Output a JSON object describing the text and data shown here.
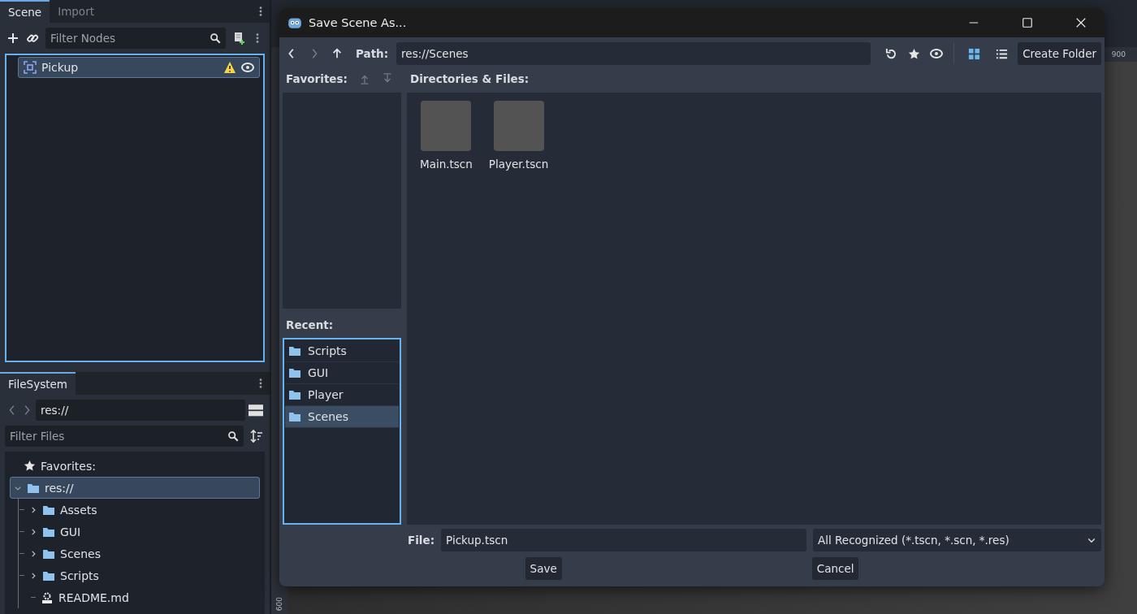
{
  "scene_dock": {
    "tabs": [
      {
        "label": "Scene",
        "selected": true
      },
      {
        "label": "Import",
        "selected": false
      }
    ],
    "filter": {
      "placeholder": "Filter Nodes"
    },
    "tree": [
      {
        "label": "Pickup",
        "selected": true,
        "warning": true,
        "visible": true
      }
    ]
  },
  "filesystem_dock": {
    "tabs": [
      {
        "label": "FileSystem",
        "selected": true
      }
    ],
    "path": "res://",
    "filter": {
      "placeholder": "Filter Files"
    },
    "tree": [
      {
        "label": "Favorites:",
        "kind": "favorites"
      },
      {
        "label": "res://",
        "kind": "folder",
        "selected": true,
        "expanded": true,
        "children": [
          {
            "label": "Assets",
            "kind": "folder",
            "selected": false,
            "expanded": false
          },
          {
            "label": "GUI",
            "kind": "folder",
            "selected": false,
            "expanded": false
          },
          {
            "label": "Scenes",
            "kind": "folder",
            "selected": false,
            "expanded": false
          },
          {
            "label": "Scripts",
            "kind": "folder",
            "selected": false,
            "expanded": false
          },
          {
            "label": "README.md",
            "kind": "file",
            "selected": false
          }
        ]
      }
    ]
  },
  "editor": {
    "ruler": {
      "top_label": "900",
      "side_label": "600"
    }
  },
  "dialog": {
    "title": "Save Scene As...",
    "path_label": "Path:",
    "path": "res://Scenes",
    "view_modes": [
      {
        "kind": "grid",
        "selected": true
      },
      {
        "kind": "list",
        "selected": false
      }
    ],
    "create_folder": "Create Folder",
    "favorites_label": "Favorites:",
    "files_label": "Directories & Files:",
    "recent_label": "Recent:",
    "recent": [
      {
        "label": "Scripts",
        "selected": false
      },
      {
        "label": "GUI",
        "selected": false
      },
      {
        "label": "Player",
        "selected": false
      },
      {
        "label": "Scenes",
        "selected": true
      }
    ],
    "files": [
      {
        "name": "Main.tscn"
      },
      {
        "name": "Player.tscn"
      }
    ],
    "file_label": "File:",
    "file_name": "Pickup.tscn",
    "filter": "All Recognized (*.tscn, *.scn, *.res)",
    "buttons": [
      {
        "label": "Save"
      },
      {
        "label": "Cancel"
      }
    ]
  }
}
